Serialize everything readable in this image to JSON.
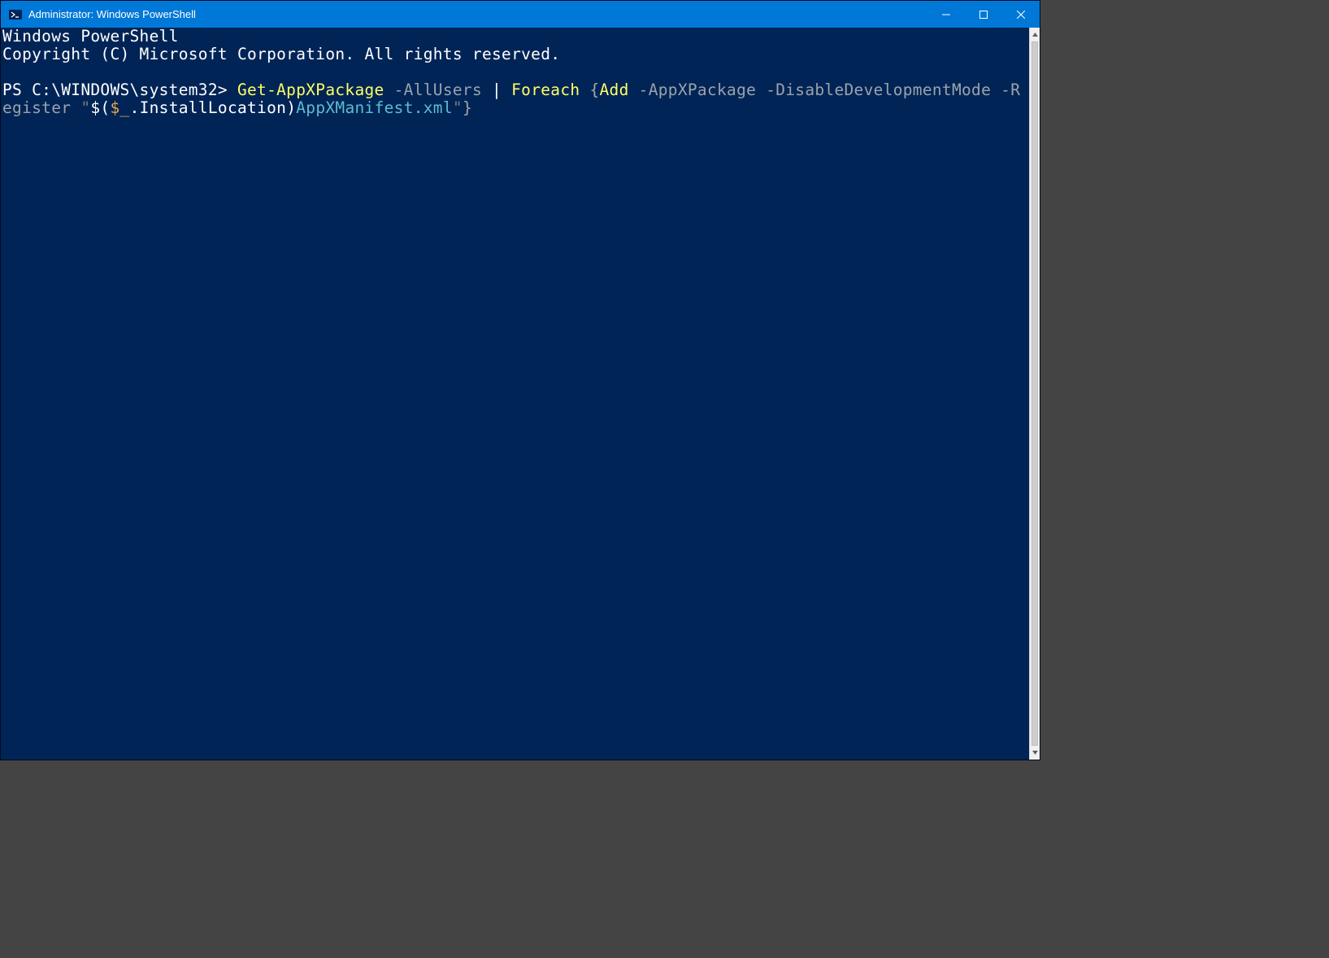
{
  "titlebar": {
    "title": "Administrator: Windows PowerShell"
  },
  "terminal": {
    "banner_line1": "Windows PowerShell",
    "banner_line2": "Copyright (C) Microsoft Corporation. All rights reserved.",
    "prompt": "PS C:\\WINDOWS\\system32> ",
    "cmd": {
      "get_appx": "Get-AppXPackage",
      "all_users": " -AllUsers ",
      "pipe": "| ",
      "foreach": "Foreach ",
      "brace_open": "{",
      "add": "Add",
      "appxpackage": " -AppXPackage ",
      "disable_dev_a": "-DisableDevelopm",
      "disable_dev_b": "entMode",
      "register": " -Register ",
      "quote_open": "\"",
      "subexpr_open": "$(",
      "dollar_under": "$_",
      "install_loc": ".InstallLocation",
      "subexpr_close": ")",
      "appx_manifest": "AppXManifest.xml",
      "quote_close": "\"",
      "brace_close": "}"
    }
  },
  "colors": {
    "bg": "#012456",
    "titlebar": "#0078d7"
  }
}
